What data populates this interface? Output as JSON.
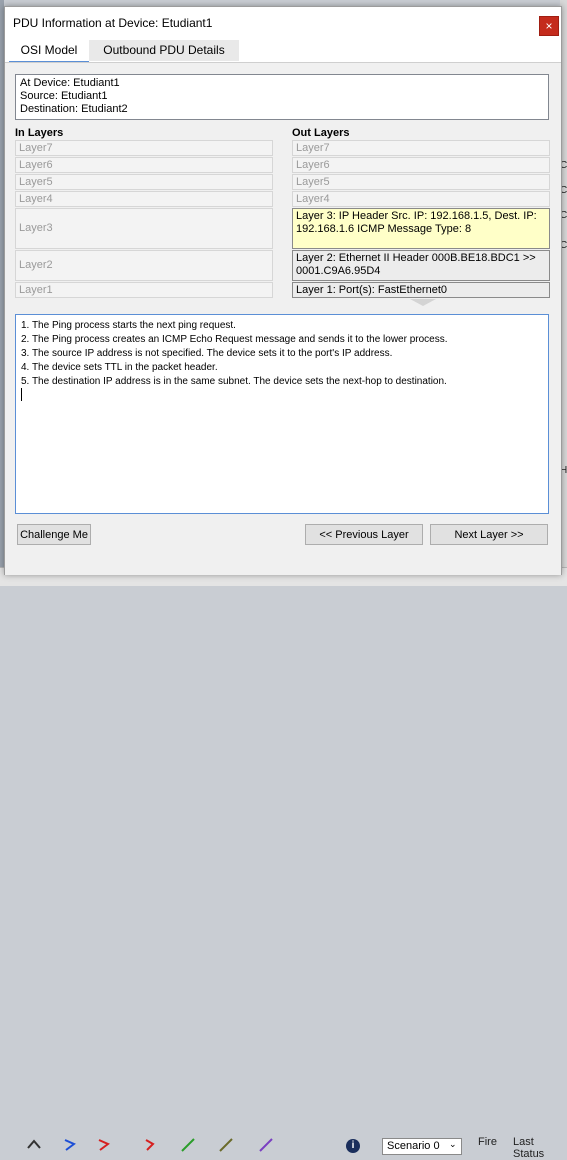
{
  "window": {
    "title": "PDU Information at Device: Etudiant1",
    "close_label": "×"
  },
  "tabs": [
    {
      "label": "OSI Model",
      "active": true
    },
    {
      "label": "Outbound PDU Details",
      "active": false
    }
  ],
  "info": {
    "device": "At Device: Etudiant1",
    "source": "Source: Etudiant1",
    "destination": "Destination: Etudiant2"
  },
  "in_layers": {
    "heading": "In Layers",
    "items": [
      "Layer7",
      "Layer6",
      "Layer5",
      "Layer4",
      "Layer3",
      "Layer2",
      "Layer1"
    ]
  },
  "out_layers": {
    "heading": "Out Layers",
    "items": [
      "Layer7",
      "Layer6",
      "Layer5",
      "Layer4",
      "Layer 3: IP Header Src. IP: 192.168.1.5, Dest. IP: 192.168.1.6 ICMP Message Type: 8",
      "Layer 2: Ethernet II Header 000B.BE18.BDC1 >> 0001.C9A6.95D4",
      "Layer 1: Port(s): FastEthernet0"
    ]
  },
  "notes": [
    "1. The Ping process starts the next ping request.",
    "2. The Ping process creates an ICMP Echo Request message and sends it to the lower process.",
    "3. The source IP address is not specified. The device sets it to the port's IP address.",
    "4. The device sets TTL in the packet header.",
    "5. The destination IP address is in the same subnet. The device sets the next-hop to destination."
  ],
  "buttons": {
    "challenge": "Challenge Me",
    "previous": "<< Previous Layer",
    "next": "Next Layer >>"
  },
  "background": {
    "scenario_label": "Scenario 0",
    "fire_label": "Fire",
    "last_status_label": "Last Status",
    "colors": {
      "accent": "#5b8fd6",
      "highlight": "#ffffc8",
      "close": "#c42b1c"
    }
  }
}
